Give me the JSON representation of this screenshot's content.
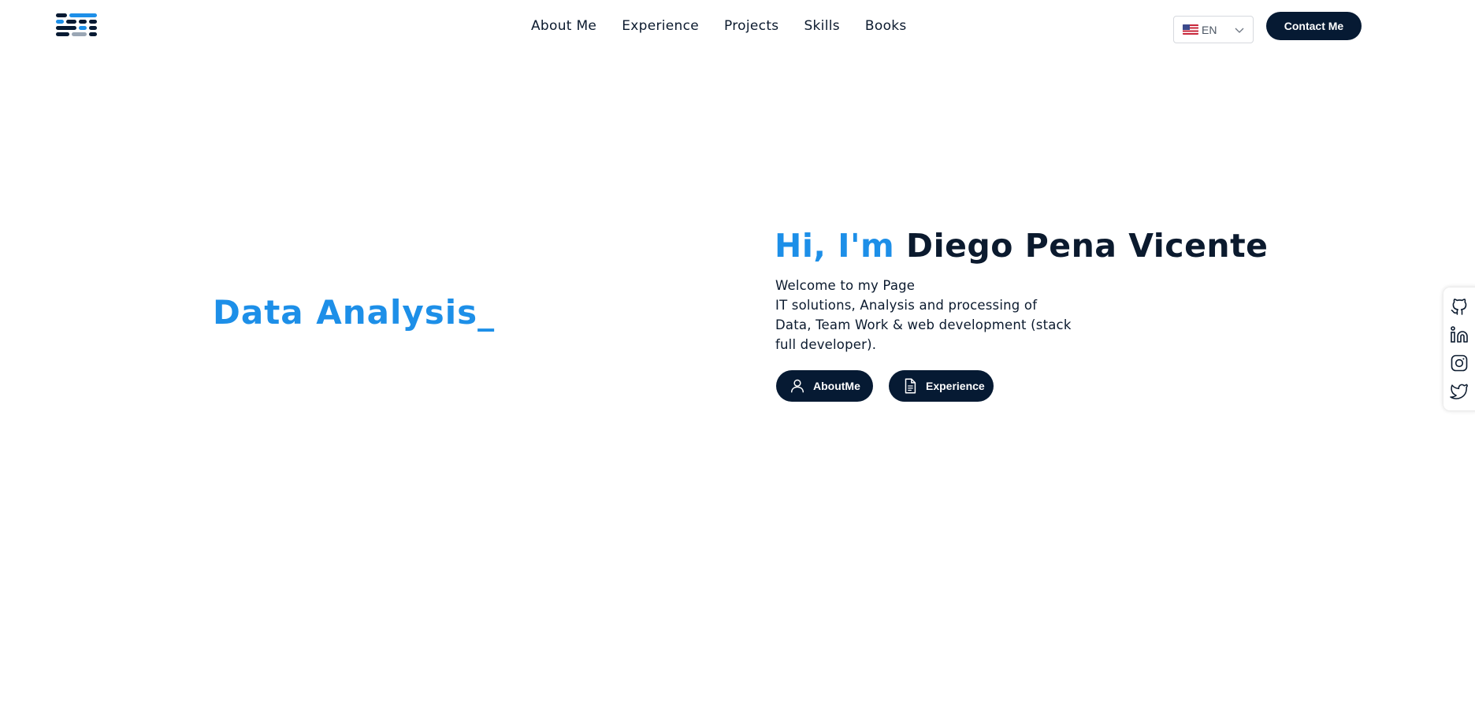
{
  "header": {
    "logo_label": "",
    "nav": [
      {
        "label": "About Me"
      },
      {
        "label": "Experience"
      },
      {
        "label": "Projects"
      },
      {
        "label": "Skills"
      },
      {
        "label": "Books"
      }
    ],
    "language": {
      "code": "EN",
      "flag": "us-flag-icon"
    },
    "contact_label": "Contact Me"
  },
  "hero": {
    "typed_text": "Data Analysis_",
    "title_prefix": "Hi, I'm",
    "title_name": "Diego Pena Vicente",
    "description_lines": [
      "Welcome to my Page",
      "IT solutions, Analysis and processing of",
      "Data, Team Work & web development (stack",
      "full developer)."
    ],
    "buttons": [
      {
        "label": "AboutMe",
        "icon": "user-icon"
      },
      {
        "label": "Experience",
        "icon": "document-icon"
      }
    ]
  },
  "social": [
    {
      "icon": "github-icon"
    },
    {
      "icon": "linkedin-icon"
    },
    {
      "icon": "instagram-icon"
    },
    {
      "icon": "twitter-icon"
    }
  ],
  "colors": {
    "accent": "#1d8fe8",
    "dark": "#061a33",
    "text": "#0b1a2e"
  }
}
